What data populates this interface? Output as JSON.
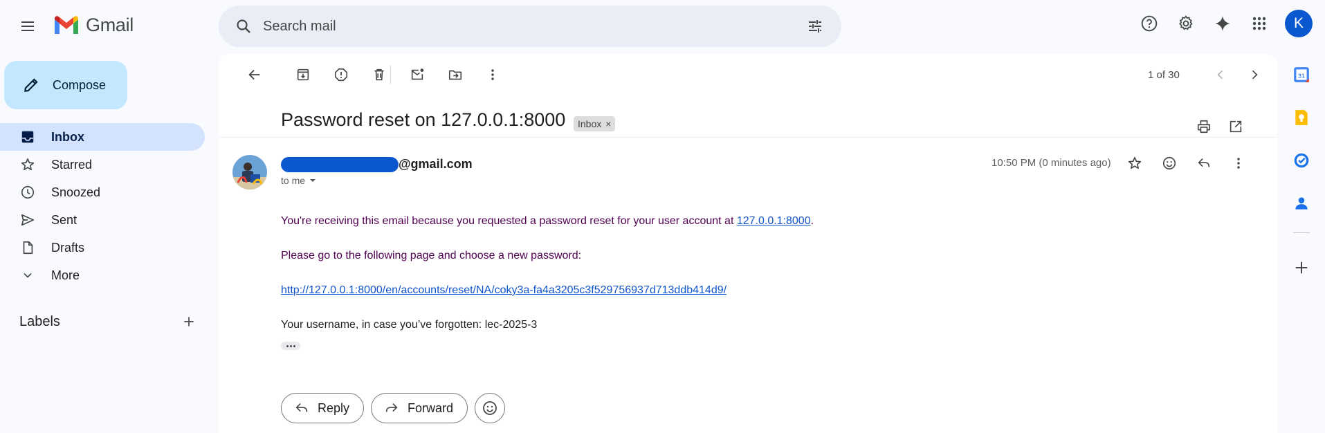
{
  "app": {
    "name": "Gmail"
  },
  "search": {
    "placeholder": "Search mail"
  },
  "header": {
    "avatar_letter": "K"
  },
  "sidebar": {
    "compose_label": "Compose",
    "items": [
      {
        "label": "Inbox",
        "icon": "inbox-icon",
        "active": true
      },
      {
        "label": "Starred",
        "icon": "star-icon"
      },
      {
        "label": "Snoozed",
        "icon": "clock-icon"
      },
      {
        "label": "Sent",
        "icon": "send-icon"
      },
      {
        "label": "Drafts",
        "icon": "draft-icon"
      },
      {
        "label": "More",
        "icon": "chevron-down-icon"
      }
    ],
    "labels_title": "Labels"
  },
  "toolbar": {
    "pager": "1 of 30"
  },
  "email": {
    "subject": "Password reset on 127.0.0.1:8000",
    "chip": "Inbox",
    "chip_close": "×",
    "sender_suffix": "@gmail.com",
    "to": "to me",
    "time": "10:50 PM (0 minutes ago)",
    "body": {
      "line1_prefix": "You're receiving this email because you requested a password reset for your user account at ",
      "line1_link": "127.0.0.1:8000",
      "line1_suffix": ".",
      "line2": "Please go to the following page and choose a new password:",
      "reset_link": "http://127.0.0.1:8000/en/accounts/reset/NA/coky3a-fa4a3205c3f529756937d713ddb414d9/",
      "line4": "Your username, in case you’ve forgotten: lec-2025-3"
    }
  },
  "actions": {
    "reply": "Reply",
    "forward": "Forward"
  },
  "colors": {
    "accent": "#0b57d0",
    "compose_bg": "#c2e7ff",
    "active_nav": "#d3e3fd",
    "visited_text": "#500050",
    "link": "#1155cc"
  }
}
